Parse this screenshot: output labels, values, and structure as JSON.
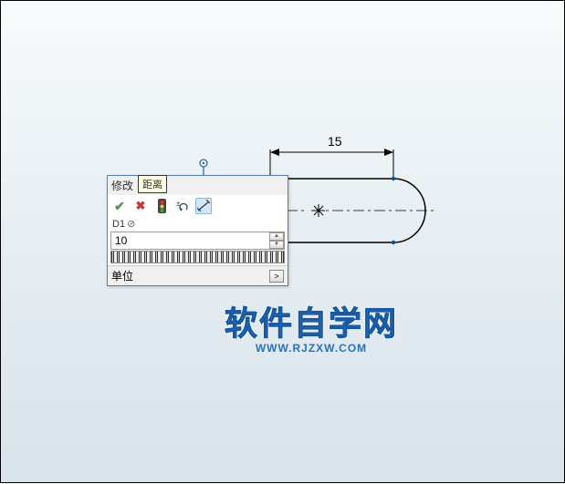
{
  "dimension": {
    "value": "15"
  },
  "dialog": {
    "title": "修改",
    "prefix": "D1",
    "tooltip": "距离",
    "value": "10",
    "unit_label": "单位",
    "expand_label": ">"
  },
  "brand": {
    "name": "软件自学网",
    "url": "WWW.RJZXW.COM"
  }
}
